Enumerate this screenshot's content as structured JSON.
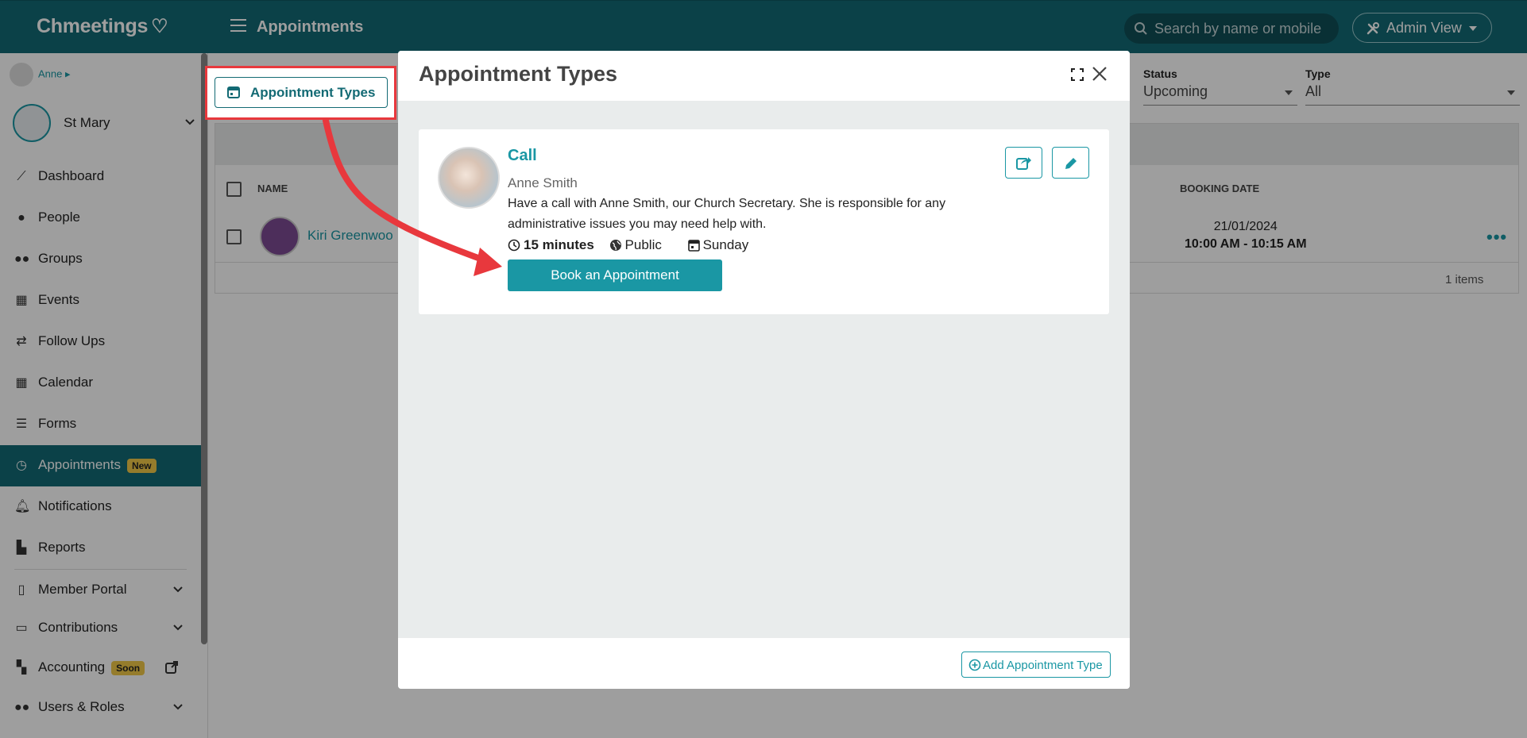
{
  "topbar": {
    "brand": "Chmeetings",
    "page_title": "Appointments",
    "search_placeholder": "Search by name or mobile",
    "admin_view_label": "Admin View"
  },
  "sidebar": {
    "user_name": "Anne",
    "church_name": "St Mary",
    "items": [
      {
        "label": "Dashboard",
        "icon": "chart-line-icon"
      },
      {
        "label": "People",
        "icon": "person-icon"
      },
      {
        "label": "Groups",
        "icon": "users-icon"
      },
      {
        "label": "Events",
        "icon": "calendar-icon"
      },
      {
        "label": "Follow Ups",
        "icon": "handshake-icon"
      },
      {
        "label": "Calendar",
        "icon": "calendar-grid-icon"
      },
      {
        "label": "Forms",
        "icon": "list-icon"
      },
      {
        "label": "Appointments",
        "icon": "clock-icon",
        "badge": "New",
        "active": true
      },
      {
        "label": "Notifications",
        "icon": "bell-icon"
      },
      {
        "label": "Reports",
        "icon": "bar-chart-icon"
      },
      {
        "label": "Member Portal",
        "icon": "mobile-icon"
      },
      {
        "label": "Contributions",
        "icon": "money-icon"
      },
      {
        "label": "Accounting",
        "icon": "grid-icon",
        "badge": "Soon"
      },
      {
        "label": "Users & Roles",
        "icon": "users-cog-icon"
      }
    ]
  },
  "content": {
    "appointment_types_button": "Appointment Types",
    "filters": {
      "status_label": "Status",
      "status_value": "Upcoming",
      "type_label": "Type",
      "type_value": "All"
    },
    "table": {
      "col_name": "NAME",
      "col_booking_date": "BOOKING DATE",
      "rows": [
        {
          "name": "Kiri Greenwoo",
          "date": "21/01/2024",
          "time": "10:00 AM - 10:15 AM"
        }
      ],
      "items_count": "1 items"
    }
  },
  "modal": {
    "title": "Appointment Types",
    "card": {
      "title": "Call",
      "owner": "Anne Smith",
      "description": "Have a call with Anne Smith, our Church Secretary. She is responsible for any administrative issues you may need help with.",
      "duration": "15 minutes",
      "visibility": "Public",
      "day": "Sunday",
      "book_button": "Book an Appointment"
    },
    "add_button": "Add Appointment Type"
  },
  "colors": {
    "brand": "#136a74",
    "accent": "#1a97a4",
    "annotation": "#e8383d"
  }
}
